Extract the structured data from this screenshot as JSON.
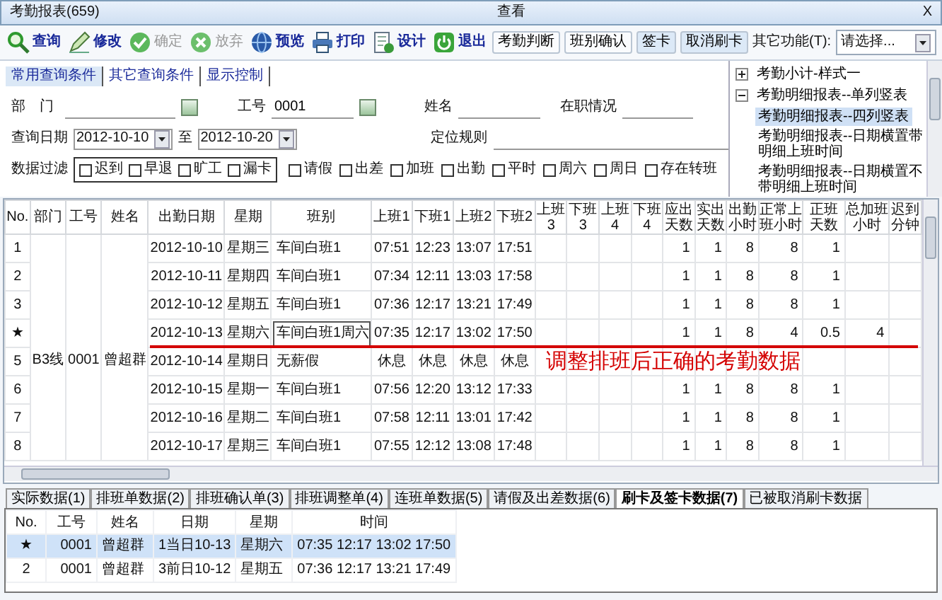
{
  "window": {
    "title": "考勤报表(659)",
    "caption": "查看",
    "close": "X"
  },
  "toolbar": {
    "tools": [
      {
        "kind": "search",
        "label": "查询",
        "disabled": false
      },
      {
        "kind": "edit",
        "label": "修改",
        "disabled": false
      },
      {
        "kind": "confirm",
        "label": "确定",
        "disabled": true
      },
      {
        "kind": "cancel",
        "label": "放弃",
        "disabled": true
      },
      {
        "kind": "preview",
        "label": "预览",
        "disabled": false
      },
      {
        "kind": "print",
        "label": "打印",
        "disabled": false
      },
      {
        "kind": "design",
        "label": "设计",
        "disabled": false
      },
      {
        "kind": "exit",
        "label": "退出",
        "disabled": false
      }
    ],
    "buttons": [
      {
        "label": "考勤判断",
        "pressed": false
      },
      {
        "label": "班别确认",
        "pressed": false
      },
      {
        "label": "签卡",
        "pressed": true
      },
      {
        "label": "取消刷卡",
        "pressed": true
      }
    ],
    "other_label": "其它功能(T):",
    "other_select": {
      "value": "请选择..."
    }
  },
  "query": {
    "tabs": [
      {
        "label": "常用查询条件",
        "selected": true
      },
      {
        "label": "其它查询条件",
        "selected": false
      },
      {
        "label": "显示控制",
        "selected": false
      }
    ],
    "fields": [
      {
        "label": "部　门",
        "picker": true
      },
      {
        "label": "工号",
        "value": "0001",
        "picker": true
      },
      {
        "label": "姓名",
        "picker": false
      },
      {
        "label": "在职情况",
        "picker": false
      }
    ],
    "date": {
      "label": "查询日期",
      "from": "2012-10-10",
      "to_label": "至",
      "to": "2012-10-20"
    },
    "locate": {
      "label": "定位规则"
    },
    "filter": {
      "label": "数据过滤",
      "grouped": [
        {
          "label": "迟到",
          "checked": false
        },
        {
          "label": "早退",
          "checked": false
        },
        {
          "label": "旷工",
          "checked": false
        },
        {
          "label": "漏卡",
          "checked": false
        }
      ],
      "others": [
        {
          "label": "请假",
          "checked": false
        },
        {
          "label": "出差",
          "checked": false
        },
        {
          "label": "加班",
          "checked": false
        },
        {
          "label": "出勤",
          "checked": false
        },
        {
          "label": "平时",
          "checked": false
        },
        {
          "label": "周六",
          "checked": false
        },
        {
          "label": "周日",
          "checked": false
        },
        {
          "label": "存在转班",
          "checked": false
        }
      ]
    }
  },
  "report_tree": {
    "items": [
      {
        "label": "考勤小计-样式一",
        "expanded": false,
        "selected": false
      },
      {
        "label": "考勤明细报表--单列竖表",
        "expanded": true,
        "selected": false,
        "children": [
          {
            "label": "考勤明细报表--四列竖表",
            "selected": true
          },
          {
            "label": "考勤明细报表--日期横置带明细上班时间",
            "selected": false
          },
          {
            "label": "考勤明细报表--日期横置不带明细上班时间",
            "selected": false
          }
        ]
      }
    ]
  },
  "main_grid": {
    "columns": [
      "No.",
      "部门",
      "工号",
      "姓名",
      "出勤日期",
      "星期",
      "班别",
      "上班1",
      "下班1",
      "上班2",
      "下班2",
      "上班3",
      "下班3",
      "上班4",
      "下班4",
      "应出天数",
      "实出天数",
      "出勤小时",
      "正常上班小时",
      "正班天数",
      "总加班小时",
      "迟到分钟"
    ],
    "group": {
      "dept": "B3线",
      "emp_id": "0001",
      "name": "曾超群"
    },
    "rows": [
      {
        "no": "1",
        "date": "2012-10-10",
        "weekday": "星期三",
        "shift": "车间白班1",
        "in1": "07:51",
        "out1": "12:23",
        "in2": "13:07",
        "out2": "17:51",
        "due_days": "1",
        "actual_days": "1",
        "work_hours": "8",
        "normal_hours": "8",
        "regular_days": "1",
        "current": false
      },
      {
        "no": "2",
        "date": "2012-10-11",
        "weekday": "星期四",
        "shift": "车间白班1",
        "in1": "07:34",
        "out1": "12:11",
        "in2": "13:03",
        "out2": "17:58",
        "due_days": "1",
        "actual_days": "1",
        "work_hours": "8",
        "normal_hours": "8",
        "regular_days": "1",
        "current": false
      },
      {
        "no": "3",
        "date": "2012-10-12",
        "weekday": "星期五",
        "shift": "车间白班1",
        "in1": "07:36",
        "out1": "12:17",
        "in2": "13:21",
        "out2": "17:49",
        "due_days": "1",
        "actual_days": "1",
        "work_hours": "8",
        "normal_hours": "8",
        "regular_days": "1",
        "current": false
      },
      {
        "no": "★",
        "date": "2012-10-13",
        "weekday": "星期六",
        "shift": "车间白班1周六",
        "in1": "07:35",
        "out1": "12:17",
        "in2": "13:02",
        "out2": "17:50",
        "due_days": "1",
        "actual_days": "1",
        "work_hours": "8",
        "normal_hours": "4",
        "regular_days": "0.5",
        "overtime_hours": "4",
        "current": true
      },
      {
        "no": "5",
        "date": "2012-10-14",
        "weekday": "星期日",
        "shift": "无薪假",
        "in1": "休息",
        "out1": "休息",
        "in2": "休息",
        "out2": "休息",
        "current": false
      },
      {
        "no": "6",
        "date": "2012-10-15",
        "weekday": "星期一",
        "shift": "车间白班1",
        "in1": "07:56",
        "out1": "12:20",
        "in2": "13:12",
        "out2": "17:33",
        "due_days": "1",
        "actual_days": "1",
        "work_hours": "8",
        "normal_hours": "8",
        "regular_days": "1",
        "current": false
      },
      {
        "no": "7",
        "date": "2012-10-16",
        "weekday": "星期二",
        "shift": "车间白班1",
        "in1": "07:58",
        "out1": "12:11",
        "in2": "13:01",
        "out2": "17:42",
        "due_days": "1",
        "actual_days": "1",
        "work_hours": "8",
        "normal_hours": "8",
        "regular_days": "1",
        "current": false
      },
      {
        "no": "8",
        "date": "2012-10-17",
        "weekday": "星期三",
        "shift": "车间白班1",
        "in1": "07:55",
        "out1": "12:12",
        "in2": "13:08",
        "out2": "17:48",
        "due_days": "1",
        "actual_days": "1",
        "work_hours": "8",
        "normal_hours": "8",
        "regular_days": "1",
        "current": false
      }
    ],
    "annotation": {
      "text": "调整排班后正确的考勤数据"
    }
  },
  "detail_tabs": [
    {
      "label": "实际数据(1)",
      "selected": false
    },
    {
      "label": "排班单数据(2)",
      "selected": false
    },
    {
      "label": "排班确认单(3)",
      "selected": false
    },
    {
      "label": "排班调整单(4)",
      "selected": false
    },
    {
      "label": "连班单数据(5)",
      "selected": false
    },
    {
      "label": "请假及出差数据(6)",
      "selected": false
    },
    {
      "label": "刷卡及签卡数据(7)",
      "selected": true
    },
    {
      "label": "已被取消刷卡数据",
      "selected": false
    }
  ],
  "detail_grid": {
    "columns": [
      "No.",
      "工号",
      "姓名",
      "日期",
      "星期",
      "时间"
    ],
    "rows": [
      {
        "no": "★",
        "emp_id": "0001",
        "name": "曾超群",
        "date": "1当日10-13",
        "weekday": "星期六",
        "time": "07:35 12:17 13:02 17:50",
        "selected": true
      },
      {
        "no": "2",
        "emp_id": "0001",
        "name": "曾超群",
        "date": "3前日10-12",
        "weekday": "星期五",
        "time": "07:36 12:17 13:21 17:49",
        "selected": false
      }
    ]
  }
}
